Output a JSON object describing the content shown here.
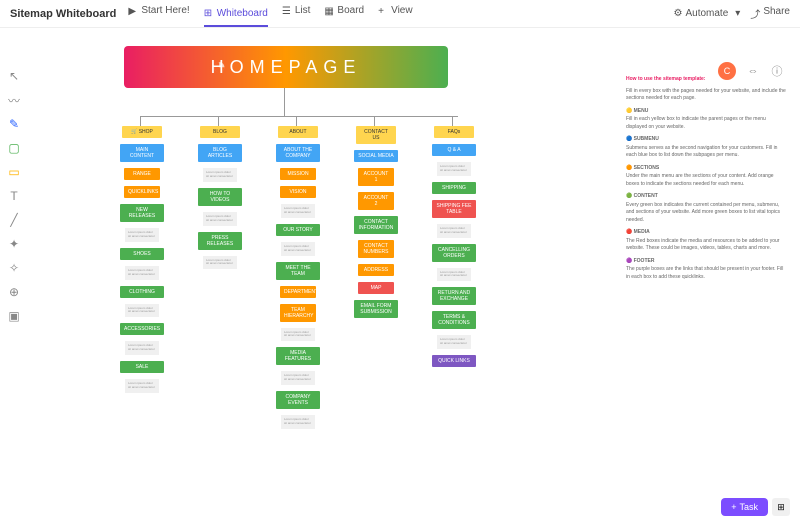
{
  "title": "Sitemap Whiteboard",
  "tabs": {
    "start": "Start Here!",
    "whiteboard": "Whiteboard",
    "list": "List",
    "board": "Board",
    "view": "View"
  },
  "automate": "Automate",
  "share": "Share",
  "homepage": "HOMEPAGE",
  "avatar": "C",
  "cols": {
    "shop": {
      "menu": "🛒 SHOP",
      "sub": "MAIN CONTENT",
      "items": [
        "RANGE",
        "QUICKLINKS",
        "NEW RELEASES",
        "SHOES",
        "CLOTHING",
        "ACCESSORIES",
        "SALE"
      ]
    },
    "blog": {
      "menu": "BLOG",
      "sub": "BLOG ARTICLES",
      "items": [
        "HOW TO VIDEOS",
        "PRESS RELEASES"
      ]
    },
    "about": {
      "menu": "ABOUT",
      "sub": "ABOUT THE COMPANY",
      "items": [
        "MISSION",
        "VISION",
        "OUR STORY",
        "MEET THE TEAM",
        "DEPARTMENTS",
        "TEAM HIERARCHY",
        "MEDIA FEATURES",
        "COMPANY EVENTS"
      ]
    },
    "contact": {
      "menu": "CONTACT US",
      "sub": "SOCIAL MEDIA",
      "items": [
        "ACCOUNT 1",
        "ACCOUNT 2",
        "CONTACT INFORMATION",
        "CONTACT NUMBERS",
        "ADDRESS",
        "MAP",
        "EMAIL FORM SUBMISSION"
      ]
    },
    "faqs": {
      "menu": "FAQs",
      "sub": "Q & A",
      "items": [
        "SHIPPING",
        "SHIPPING FEE TABLE",
        "CANCELLING ORDERS",
        "RETURN AND EXCHANGE",
        "TERMS & CONDITIONS",
        "QUICK LINKS"
      ]
    }
  },
  "legend": {
    "title": "How to use the sitemap template:",
    "intro": "Fill in every box with the pages needed for your website, and include the sections needed for each page.",
    "menu": {
      "h": "🟡 MENU",
      "t": "Fill in each yellow box to indicate the parent pages or the menu displayed on your website."
    },
    "submenu": {
      "h": "🔵 SUBMENU",
      "t": "Submenu serves as the second navigation for your customers. Fill in each blue box to list down the subpages per menu."
    },
    "sections": {
      "h": "🟠 SECTIONS",
      "t": "Under the main menu are the sections of your content. Add orange boxes to indicate the sections needed for each menu."
    },
    "content": {
      "h": "🟢 CONTENT",
      "t": "Every green box indicates the current contained per menu, submenu, and sections of your website. Add more green boxes to list vital topics needed."
    },
    "media": {
      "h": "🔴 MEDIA",
      "t": "The Red boxes indicate the media and resources to be added to your website. These could be images, videos, tables, charts and more."
    },
    "footer": {
      "h": "🟣 FOOTER",
      "t": "The purple boxes are the links that should be present in your footer. Fill in each box to add these quicklinks."
    }
  },
  "task": "Task",
  "note": "Lorem ipsum dolor sit amet consectetur"
}
